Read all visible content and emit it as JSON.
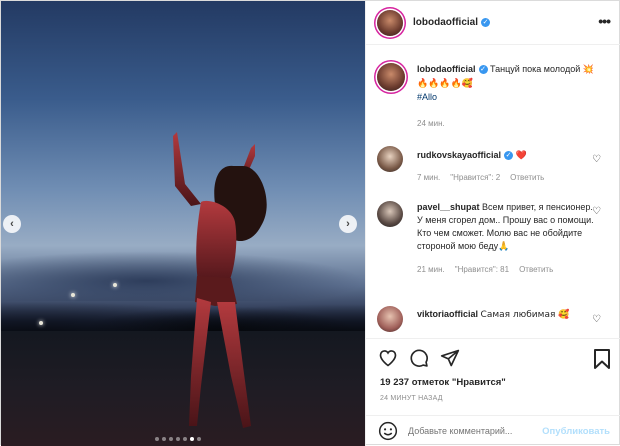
{
  "post": {
    "username": "lobodaofficial",
    "caption": {
      "text": "Танцуй пока молодой",
      "emojis": "💥🔥🔥🔥🔥🥰",
      "hashtag": "#Allo",
      "time": "24 мин."
    },
    "photo": {
      "carousel_dots": 7,
      "active_dot": 6
    },
    "comments": [
      {
        "username": "rudkovskayaofficial",
        "text": "❤️",
        "time": "7 мин.",
        "likes_label": "\"Нравится\": 2",
        "reply_label": "Ответить"
      },
      {
        "username": "pavel__shupat",
        "text": "Всем привет, я пенсионер. У меня сгорел дом.. Прошу вас о помощи. Кто чем сможет. Молю вас не обойдите стороной мою беду🙏",
        "time": "21 мин.",
        "likes_label": "\"Нравится\": 81",
        "reply_label": "Ответить"
      },
      {
        "username": "viktoriaofficial",
        "text": "Самая любимая 🥰"
      }
    ],
    "likes_text": "19 237 отметок \"Нравится\"",
    "time_ago": "24 минут назад",
    "comment_placeholder": "Добавьте комментарий...",
    "publish_label": "Опубликовать"
  },
  "icons": {
    "nav_left": "‹",
    "nav_right": "›",
    "more": "•••",
    "verified": "✓",
    "heart": "♡"
  },
  "colors": {
    "verified_blue": "#3897f0",
    "publish_disabled": "#b2dffc",
    "like_red": "#ed4956",
    "story_ring": "#d6249f"
  }
}
